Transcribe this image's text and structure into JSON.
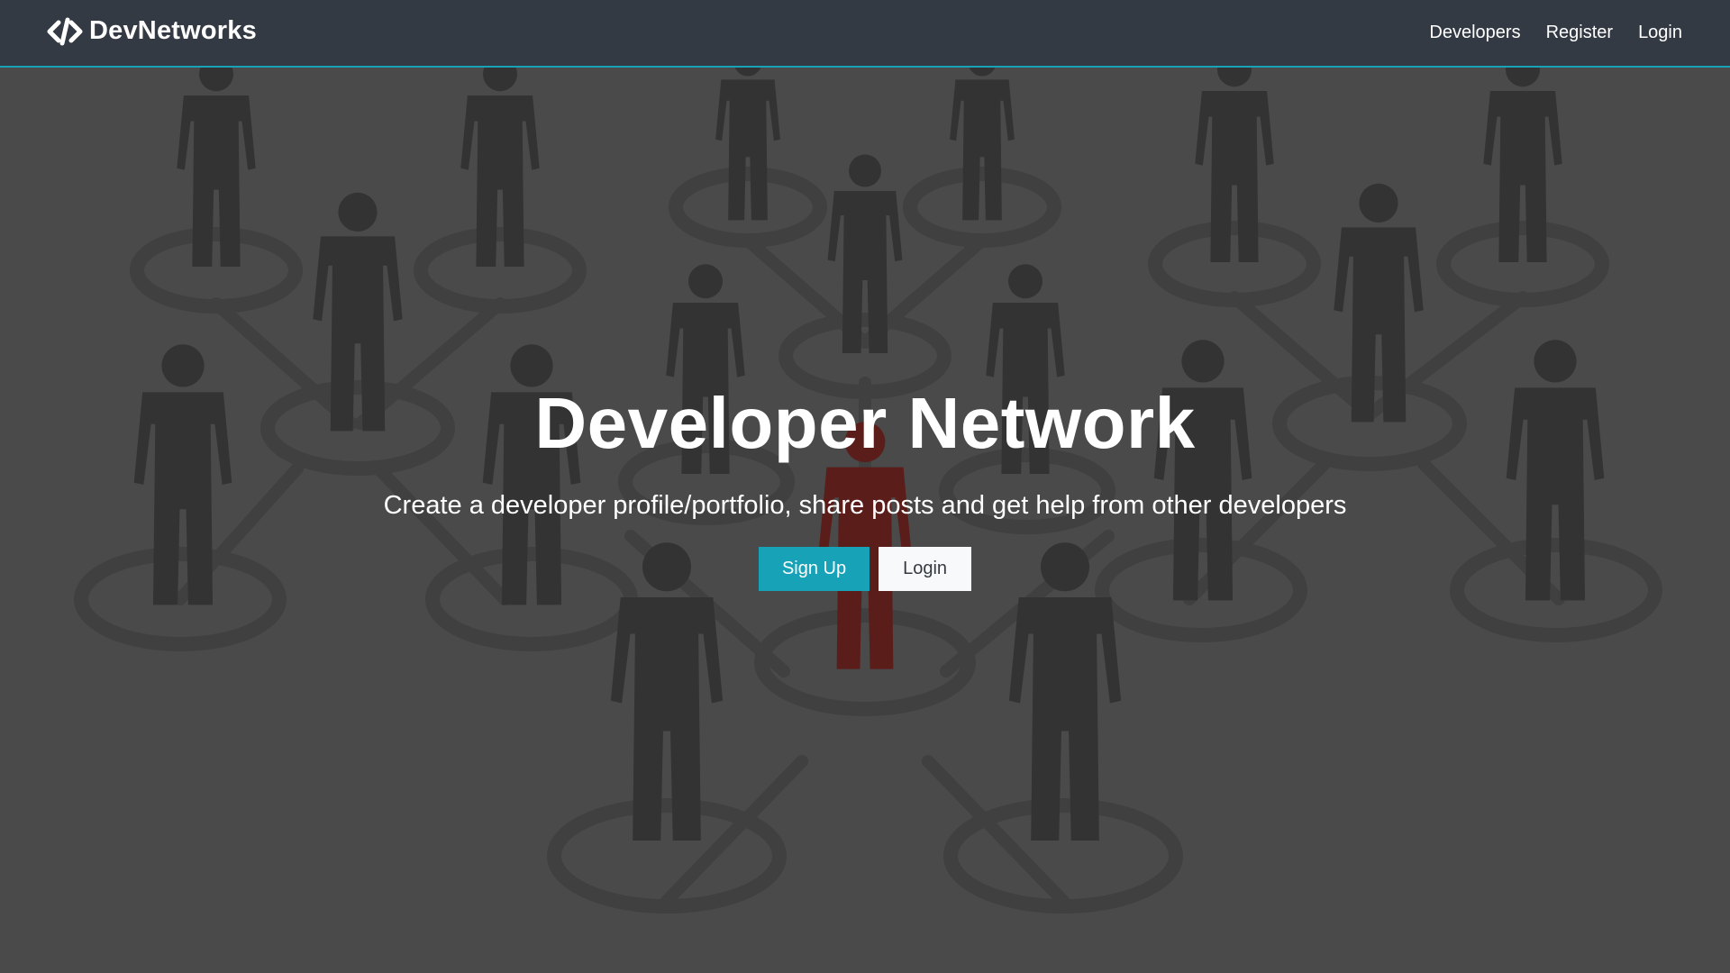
{
  "navbar": {
    "brand_label": "DevNetworks",
    "brand_icon": "code-icon",
    "links": [
      {
        "label": "Developers"
      },
      {
        "label": "Register"
      },
      {
        "label": "Login"
      }
    ]
  },
  "hero": {
    "title": "Developer Network",
    "lead": "Create a developer profile/portfolio, share posts and get help from other developers",
    "signup_label": "Sign Up",
    "login_label": "Login",
    "background_image": "people-network-illustration"
  },
  "colors": {
    "navbar_bg": "#343a43",
    "accent": "#17a2b8",
    "light_button": "#f8f9fa",
    "background": "#4a4a4b",
    "highlight_person": "#5a1d1a"
  }
}
